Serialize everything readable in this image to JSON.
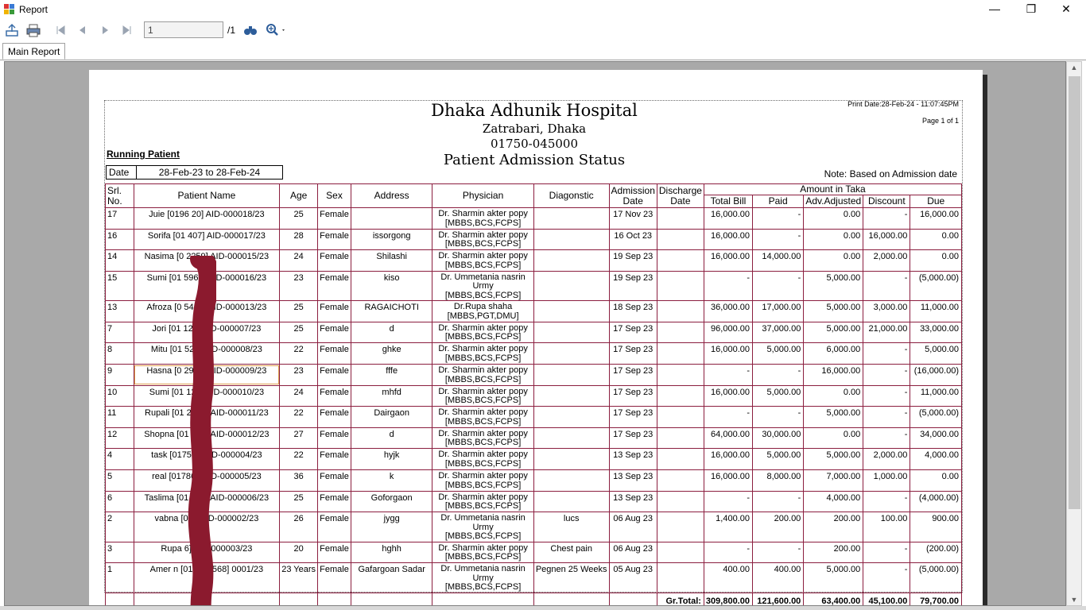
{
  "window": {
    "title": "Report",
    "controls": {
      "minimize": "—",
      "maximize": "❐",
      "close": "✕"
    }
  },
  "toolbar": {
    "page_value": "1",
    "page_total": "/1"
  },
  "tabs": [
    {
      "label": "Main Report"
    }
  ],
  "report": {
    "hospital": "Dhaka Adhunik Hospital",
    "address": "Zatrabari, Dhaka",
    "phone": "01750-045000",
    "title": "Patient Admission Status",
    "print_date": "Print Date:28-Feb-24 - 11:07:45PM",
    "page_of": "Page 1 of 1",
    "running_label": "Running Patient",
    "date_label": "Date",
    "date_range": "28-Feb-23 to 28-Feb-24",
    "note": "Note: Based on Admission date"
  },
  "table": {
    "headers": {
      "srl": "Srl. No.",
      "name": "Patient Name",
      "age": "Age",
      "sex": "Sex",
      "address": "Address",
      "physician": "Physician",
      "diagnostic": "Diagonstic",
      "adm_date": "Admission Date",
      "dis_date": "Discharge Date",
      "amount_group": "Amount in Taka",
      "total_bill": "Total Bill",
      "paid": "Paid",
      "adv_adjusted": "Adv.Adjusted",
      "discount": "Discount",
      "due": "Due"
    },
    "rows": [
      {
        "srl": "17",
        "name": "Juie [0196     20] AID-000018/23",
        "age": "25",
        "sex": "Female",
        "address": "",
        "physician": "Dr. Sharmin akter popy [MBBS,BCS,FCPS]",
        "diagnostic": "",
        "adm": "17 Nov 23",
        "dis": "",
        "total": "16,000.00",
        "paid": "-",
        "adv": "0.00",
        "disc": "-",
        "due": "16,000.00"
      },
      {
        "srl": "16",
        "name": "Sorifa [01      407] AID-000017/23",
        "age": "28",
        "sex": "Female",
        "address": "issorgong",
        "physician": "Dr. Sharmin akter popy [MBBS,BCS,FCPS]",
        "diagnostic": "",
        "adm": "16 Oct 23",
        "dis": "",
        "total": "16,000.00",
        "paid": "-",
        "adv": "0.00",
        "disc": "16,000.00",
        "due": "0.00"
      },
      {
        "srl": "14",
        "name": "Nasima [0     2259] AID-000015/23",
        "age": "24",
        "sex": "Female",
        "address": "Shilashi",
        "physician": "Dr. Sharmin akter popy [MBBS,BCS,FCPS]",
        "diagnostic": "",
        "adm": "19 Sep 23",
        "dis": "",
        "total": "16,000.00",
        "paid": "14,000.00",
        "adv": "0.00",
        "disc": "2,000.00",
        "due": "0.00"
      },
      {
        "srl": "15",
        "name": "Sumi [01     5966] AID-000016/23",
        "age": "23",
        "sex": "Female",
        "address": "kiso",
        "physician": "Dr. Ummetania nasrin Urmy [MBBS,BCS,FCPS]",
        "diagnostic": "",
        "adm": "19 Sep 23",
        "dis": "",
        "total": "-",
        "paid": "-",
        "adv": "5,000.00",
        "disc": "-",
        "due": "(5,000.00)"
      },
      {
        "srl": "13",
        "name": "Afroza [0     5450] AID-000013/23",
        "age": "25",
        "sex": "Female",
        "address": "RAGAICHOTI",
        "physician": "Dr.Rupa shaha [MBBS,PGT,DMU]",
        "diagnostic": "",
        "adm": "18 Sep 23",
        "dis": "",
        "total": "36,000.00",
        "paid": "17,000.00",
        "adv": "5,000.00",
        "disc": "3,000.00",
        "due": "11,000.00"
      },
      {
        "srl": "7",
        "name": "Jori [01     128] AID-000007/23",
        "age": "25",
        "sex": "Female",
        "address": "d",
        "physician": "Dr. Sharmin akter popy [MBBS,BCS,FCPS]",
        "diagnostic": "",
        "adm": "17 Sep 23",
        "dis": "",
        "total": "96,000.00",
        "paid": "37,000.00",
        "adv": "5,000.00",
        "disc": "21,000.00",
        "due": "33,000.00"
      },
      {
        "srl": "8",
        "name": "Mitu [01     526] AID-000008/23",
        "age": "22",
        "sex": "Female",
        "address": "ghke",
        "physician": "Dr. Sharmin akter popy [MBBS,BCS,FCPS]",
        "diagnostic": "",
        "adm": "17 Sep 23",
        "dis": "",
        "total": "16,000.00",
        "paid": "5,000.00",
        "adv": "6,000.00",
        "disc": "-",
        "due": "5,000.00"
      },
      {
        "srl": "9",
        "name": "Hasna [0     2952] AID-000009/23",
        "age": "23",
        "sex": "Female",
        "address": "fffe",
        "physician": "Dr. Sharmin akter popy [MBBS,BCS,FCPS]",
        "diagnostic": "",
        "adm": "17 Sep 23",
        "dis": "",
        "total": "-",
        "paid": "-",
        "adv": "16,000.00",
        "disc": "-",
        "due": "(16,000.00)"
      },
      {
        "srl": "10",
        "name": "Sumi [01     121] AID-000010/23",
        "age": "24",
        "sex": "Female",
        "address": "mhfd",
        "physician": "Dr. Sharmin akter popy [MBBS,BCS,FCPS]",
        "diagnostic": "",
        "adm": "17 Sep 23",
        "dis": "",
        "total": "16,000.00",
        "paid": "5,000.00",
        "adv": "0.00",
        "disc": "-",
        "due": "11,000.00"
      },
      {
        "srl": "11",
        "name": "Rupali [01     2948] AID-000011/23",
        "age": "22",
        "sex": "Female",
        "address": "Dairgaon",
        "physician": "Dr. Sharmin akter popy [MBBS,BCS,FCPS]",
        "diagnostic": "",
        "adm": "17 Sep 23",
        "dis": "",
        "total": "-",
        "paid": "-",
        "adv": "5,000.00",
        "disc": "-",
        "due": "(5,000.00)"
      },
      {
        "srl": "12",
        "name": "Shopna [01     956] AID-000012/23",
        "age": "27",
        "sex": "Female",
        "address": "d",
        "physician": "Dr. Sharmin akter popy [MBBS,BCS,FCPS]",
        "diagnostic": "",
        "adm": "17 Sep 23",
        "dis": "",
        "total": "64,000.00",
        "paid": "30,000.00",
        "adv": "0.00",
        "disc": "-",
        "due": "34,000.00"
      },
      {
        "srl": "4",
        "name": "task [0175     0] AID-000004/23",
        "age": "22",
        "sex": "Female",
        "address": "hyjk",
        "physician": "Dr. Sharmin akter popy [MBBS,BCS,FCPS]",
        "diagnostic": "",
        "adm": "13 Sep 23",
        "dis": "",
        "total": "16,000.00",
        "paid": "5,000.00",
        "adv": "5,000.00",
        "disc": "2,000.00",
        "due": "4,000.00"
      },
      {
        "srl": "5",
        "name": "real [01786     ] AID-000005/23",
        "age": "36",
        "sex": "Female",
        "address": "k",
        "physician": "Dr. Sharmin akter popy [MBBS,BCS,FCPS]",
        "diagnostic": "",
        "adm": "13 Sep 23",
        "dis": "",
        "total": "16,000.00",
        "paid": "8,000.00",
        "adv": "7,000.00",
        "disc": "1,000.00",
        "due": "0.00"
      },
      {
        "srl": "6",
        "name": "Taslima [01     250] AID-000006/23",
        "age": "25",
        "sex": "Female",
        "address": "Goforgaon",
        "physician": "Dr. Sharmin akter popy [MBBS,BCS,FCPS]",
        "diagnostic": "",
        "adm": "13 Sep 23",
        "dis": "",
        "total": "-",
        "paid": "-",
        "adv": "4,000.00",
        "disc": "-",
        "due": "(4,000.00)"
      },
      {
        "srl": "2",
        "name": "vabna [0     5] AID-000002/23",
        "age": "26",
        "sex": "Female",
        "address": "jygg",
        "physician": "Dr. Ummetania nasrin Urmy [MBBS,BCS,FCPS]",
        "diagnostic": "lucs",
        "adm": "06 Aug 23",
        "dis": "",
        "total": "1,400.00",
        "paid": "200.00",
        "adv": "200.00",
        "disc": "100.00",
        "due": "900.00"
      },
      {
        "srl": "3",
        "name": "Rupa     6] AID-000003/23",
        "age": "20",
        "sex": "Female",
        "address": "hghh",
        "physician": "Dr. Sharmin akter popy [MBBS,BCS,FCPS]",
        "diagnostic": "Chest pain",
        "adm": "06 Aug 23",
        "dis": "",
        "total": "-",
        "paid": "-",
        "adv": "200.00",
        "disc": "-",
        "due": "(200.00)"
      },
      {
        "srl": "1",
        "name": "Amer     n [014789568]      0001/23",
        "age": "23 Years",
        "sex": "Female",
        "address": "Gafargoan Sadar",
        "physician": "Dr. Ummetania nasrin Urmy [MBBS,BCS,FCPS]",
        "diagnostic": "Pegnen 25 Weeks",
        "adm": "05 Aug 23",
        "dis": "",
        "total": "400.00",
        "paid": "400.00",
        "adv": "5,000.00",
        "disc": "-",
        "due": "(5,000.00)"
      }
    ],
    "totals": {
      "label": "Gr.Total:",
      "total": "309,800.00",
      "paid": "121,600.00",
      "adv": "63,400.00",
      "disc": "45,100.00",
      "due": "79,700.00"
    }
  },
  "icons": [
    "export-icon",
    "print-icon",
    "first-page-icon",
    "prev-page-icon",
    "next-page-icon",
    "last-page-icon",
    "find-icon",
    "zoom-icon"
  ],
  "colors": {
    "grid_line": "#8b1e3f",
    "scribble": "#8b1a2e",
    "viewer_bg": "#a9a9a9"
  }
}
